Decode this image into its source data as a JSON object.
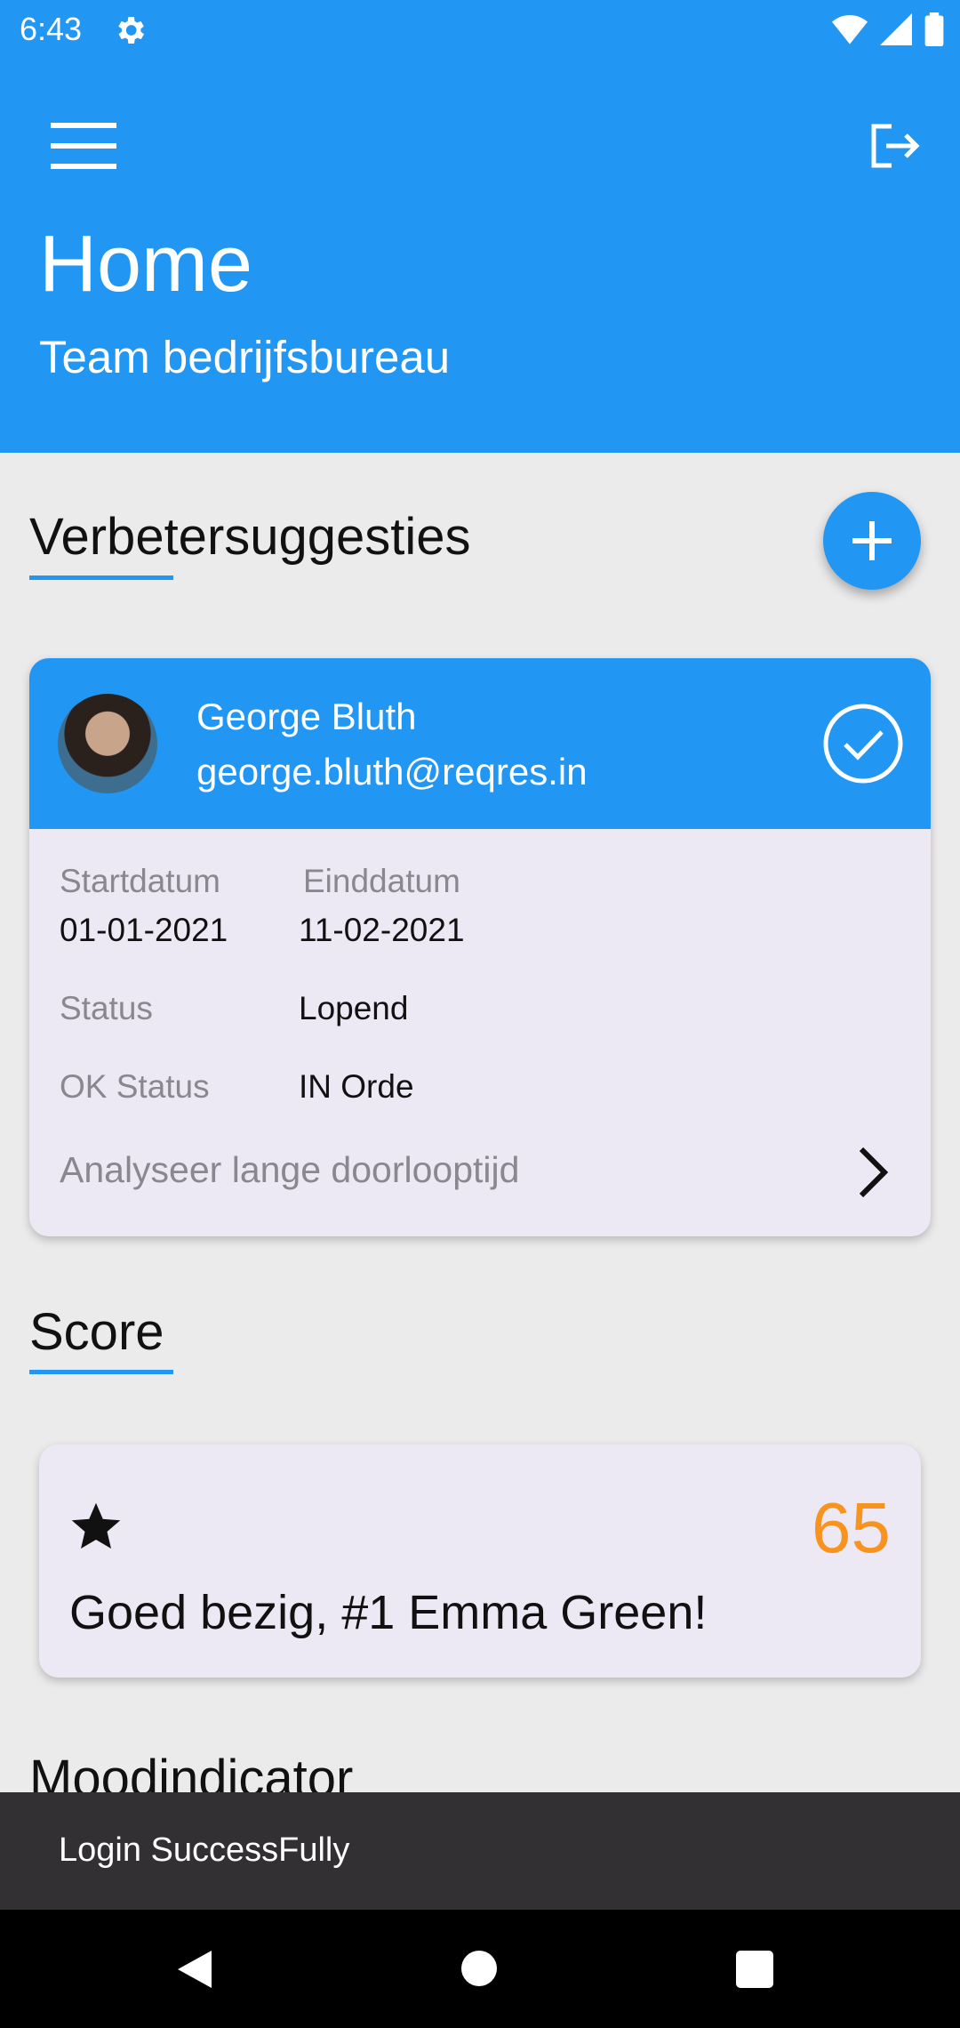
{
  "status_bar": {
    "time": "6:43"
  },
  "header": {
    "title": "Home",
    "subtitle": "Team bedrijfsbureau"
  },
  "suggestions": {
    "section_title": "Verbetersuggesties",
    "card": {
      "name": "George Bluth",
      "email": "george.bluth@reqres.in",
      "start_label": "Startdatum",
      "start_value": "01-01-2021",
      "end_label": "Einddatum",
      "end_value": "11-02-2021",
      "status_label": "Status",
      "status_value": "Lopend",
      "ok_label": "OK Status",
      "ok_value": "IN Orde",
      "action_label": "Analyseer lange doorlooptijd"
    }
  },
  "score": {
    "section_title": "Score",
    "value": "65",
    "message": "Goed bezig, #1 Emma Green!"
  },
  "mood": {
    "section_title": "Moodindicator"
  },
  "snackbar": {
    "text": "Login SuccessFully"
  },
  "colors": {
    "primary": "#2196f3",
    "score": "#f7931e",
    "card_bg": "#ece9f4"
  }
}
